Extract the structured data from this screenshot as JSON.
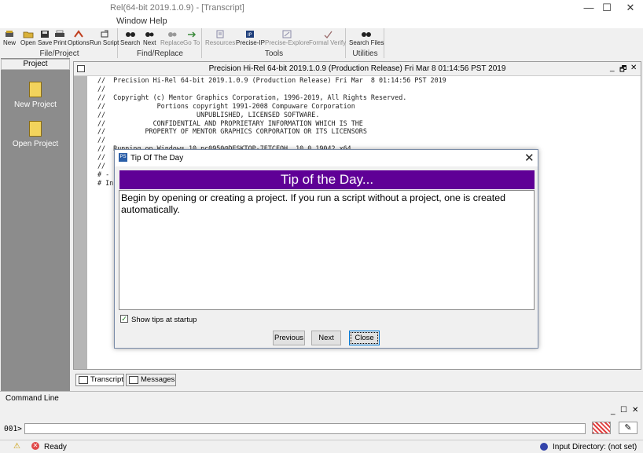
{
  "window": {
    "title": "Rel(64-bit 2019.1.0.9) - [Transcript]",
    "minimize": "—",
    "maximize": "☐",
    "close": "✕"
  },
  "menu": {
    "items": [
      "Window",
      "Help"
    ]
  },
  "toolbar": {
    "groups": [
      {
        "label": "File/Project",
        "buttons": [
          "New",
          "Open",
          "Save",
          "Print",
          "Options",
          "Run Script"
        ]
      },
      {
        "label": "Find/Replace",
        "buttons": [
          "Search",
          "Next",
          "Replace",
          "Go To"
        ]
      },
      {
        "label": "Tools",
        "buttons": [
          "Resources",
          "Precise-IP",
          "Precise-Explore",
          "Formal Verify"
        ]
      },
      {
        "label": "Utilities",
        "buttons": [
          "Search Files"
        ]
      }
    ]
  },
  "project_panel": {
    "header": "Project",
    "items": [
      "New Project",
      "Open Project"
    ]
  },
  "transcript": {
    "caption": "Precision Hi-Rel 64-bit 2019.1.0.9 (Production Release) Fri Mar  8 01:14:56 PST 2019",
    "window_controls": [
      "_",
      "🗗",
      "✕"
    ],
    "lines": [
      "//  Precision Hi-Rel 64-bit 2019.1.0.9 (Production Release) Fri Mar  8 01:14:56 PST 2019",
      "//",
      "//  Copyright (c) Mentor Graphics Corporation, 1996-2019, All Rights Reserved.",
      "//             Portions copyright 1991-2008 Compuware Corporation",
      "//                       UNPUBLISHED, LICENSED SOFTWARE.",
      "//            CONFIDENTIAL AND PROPRIETARY INFORMATION WHICH IS THE",
      "//          PROPERTY OF MENTOR GRAPHICS CORPORATION OR ITS LICENSORS",
      "//",
      "//  Running on Windows 10 pc0950@DESKTOP-7ETCFOH  10.0.19042 x64",
      "//",
      "//",
      "# -",
      "# In"
    ]
  },
  "bottom_tabs": [
    "Transcript",
    "Messages"
  ],
  "command_line": {
    "label": "Command Line",
    "prompt": "001>",
    "value": ""
  },
  "status": {
    "text": "Ready",
    "input_directory": "Input Directory: (not set)"
  },
  "dialog": {
    "title": "Tip Of The Day",
    "heading": "Tip of the Day...",
    "tip": "Begin by opening or creating a project. If you run a script without a project, one is created automatically.",
    "show_tips_label": "Show tips at startup",
    "show_tips_checked": true,
    "buttons": {
      "previous": "Previous",
      "next": "Next",
      "close": "Close"
    }
  },
  "colors": {
    "banner": "#5f0096",
    "panel": "#8c8c8c"
  }
}
